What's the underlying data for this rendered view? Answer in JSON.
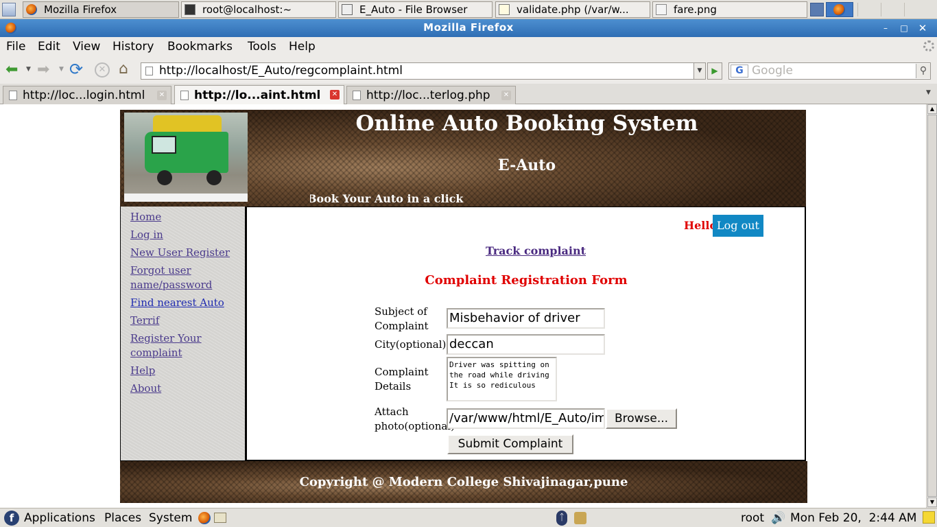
{
  "taskbar_top": {
    "tasks": [
      {
        "label": "Mozilla Firefox"
      },
      {
        "label": "root@localhost:~"
      },
      {
        "label": "E_Auto - File Browser"
      },
      {
        "label": "validate.php (/var/w..."
      },
      {
        "label": "fare.png"
      }
    ]
  },
  "window": {
    "title": "Mozilla Firefox"
  },
  "menubar": {
    "items": [
      "File",
      "Edit",
      "View",
      "History",
      "Bookmarks",
      "Tools",
      "Help"
    ]
  },
  "navbar": {
    "url": "http://localhost/E_Auto/regcomplaint.html",
    "search_placeholder": "Google"
  },
  "tabs": [
    {
      "label": "http://loc...login.html",
      "active": false
    },
    {
      "label": "http://lo...aint.html",
      "active": true
    },
    {
      "label": "http://loc...terlog.php",
      "active": false
    }
  ],
  "page": {
    "header": {
      "title": "Online Auto Booking System",
      "subtitle": "E-Auto",
      "marquee": "Book Your Auto in a click"
    },
    "sidebar": {
      "links": [
        "Home",
        "Log in",
        "New User Register",
        "Forgot user name/password",
        "Find nearest Auto",
        "Terrif",
        "Register Your complaint",
        "Help",
        "About"
      ]
    },
    "main": {
      "hello": "Hello",
      "logout": "Log out",
      "track_link": "Track complaint",
      "form_title": "Complaint Registration Form",
      "subject_label": "Subject of Complaint",
      "subject_value": "Misbehavior of driver",
      "city_label": "City(optional)",
      "city_value": "deccan",
      "details_label": "Complaint Details",
      "details_value": "Driver was spitting on\nthe road while driving\nIt is so rediculous",
      "photo_label": "Attach photo(optional)",
      "photo_value": "/var/www/html/E_Auto/im",
      "browse": "Browse...",
      "submit": "Submit Complaint"
    },
    "footer": {
      "text": "Copyright @ Modern College Shivajinagar,pune"
    }
  },
  "panel_bottom": {
    "applications": "Applications",
    "places": "Places",
    "system": "System",
    "user": "root",
    "clock": "Mon Feb 20,  2:44 AM"
  }
}
